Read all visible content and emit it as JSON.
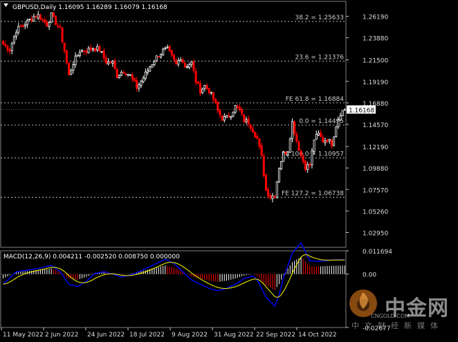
{
  "symbol_info": "GBPUSD,Daily",
  "ohlc": [
    "1.16095",
    "1.16289",
    "1.16079",
    "1.16168"
  ],
  "macd_label": "MACD(12,26,9)",
  "macd_values": [
    "0.004211",
    "-0.002520",
    "0.008750",
    "0.000000"
  ],
  "current_price": "1.16168",
  "colors": {
    "bull": "#ffffff",
    "bear": "#ff0000",
    "macd_line": "#0000ff",
    "signal_line": "#ffff00",
    "grid": "#808080"
  },
  "watermark": {
    "cn": "中金网",
    "en": "CNGOLD.COM",
    "sub": "中文财经新媒体"
  },
  "chart_data": {
    "type": "candlestick",
    "price_axis": {
      "ylim": [
        1.0135,
        1.2779
      ],
      "ticks": [
        "1.26190",
        "1.23880",
        "1.21500",
        "1.19190",
        "1.16880",
        "1.14570",
        "1.12190",
        "1.09880",
        "1.07570",
        "1.05260",
        "1.02950"
      ]
    },
    "time_axis": [
      "11 May 2022",
      "2 Jun 2022",
      "24 Jun 2022",
      "18 Jul 2022",
      "9 Aug 2022",
      "31 Aug 2022",
      "22 Sep 2022",
      "14 Oct 2022"
    ],
    "fib_levels": [
      {
        "label": "38.2 = 1.25633",
        "value": 1.25633
      },
      {
        "label": "23.6 = 1.21376",
        "value": 1.21376
      },
      {
        "label": "FE 61.8 = 1.16884",
        "value": 1.16884
      },
      {
        "label": "0.0 = 1.14495",
        "value": 1.14495
      },
      {
        "label": "FE 100.0 = 1.10957",
        "value": 1.10957
      },
      {
        "label": "FE 127.2 = 1.06738",
        "value": 1.06738
      }
    ],
    "macd_axis": {
      "ylim": [
        -0.02677,
        0.011694
      ],
      "ticks": [
        "0.011694",
        "0.00",
        "-0.02677"
      ]
    },
    "anchors": [
      [
        0,
        1.232
      ],
      [
        3,
        1.226
      ],
      [
        6,
        1.247
      ],
      [
        9,
        1.252
      ],
      [
        12,
        1.258
      ],
      [
        14,
        1.262
      ],
      [
        16,
        1.263
      ],
      [
        18,
        1.258
      ],
      [
        20,
        1.253
      ],
      [
        22,
        1.263
      ],
      [
        24,
        1.255
      ],
      [
        26,
        1.247
      ],
      [
        28,
        1.225
      ],
      [
        30,
        1.198
      ],
      [
        32,
        1.212
      ],
      [
        35,
        1.225
      ],
      [
        38,
        1.225
      ],
      [
        41,
        1.228
      ],
      [
        44,
        1.226
      ],
      [
        47,
        1.213
      ],
      [
        50,
        1.212
      ],
      [
        52,
        1.198
      ],
      [
        55,
        1.204
      ],
      [
        58,
        1.198
      ],
      [
        61,
        1.185
      ],
      [
        64,
        1.196
      ],
      [
        67,
        1.208
      ],
      [
        70,
        1.218
      ],
      [
        73,
        1.225
      ],
      [
        75,
        1.226
      ],
      [
        77,
        1.218
      ],
      [
        79,
        1.21
      ],
      [
        81,
        1.218
      ],
      [
        83,
        1.208
      ],
      [
        86,
        1.212
      ],
      [
        88,
        1.192
      ],
      [
        90,
        1.182
      ],
      [
        92,
        1.187
      ],
      [
        94,
        1.182
      ],
      [
        96,
        1.173
      ],
      [
        98,
        1.16
      ],
      [
        100,
        1.152
      ],
      [
        102,
        1.153
      ],
      [
        104,
        1.157
      ],
      [
        106,
        1.165
      ],
      [
        108,
        1.16
      ],
      [
        110,
        1.15
      ],
      [
        112,
        1.148
      ],
      [
        114,
        1.14
      ],
      [
        116,
        1.13
      ],
      [
        118,
        1.11
      ],
      [
        120,
        1.075
      ],
      [
        122,
        1.068
      ],
      [
        124,
        1.07
      ],
      [
        126,
        1.1
      ],
      [
        128,
        1.114
      ],
      [
        130,
        1.118
      ],
      [
        132,
        1.148
      ],
      [
        134,
        1.128
      ],
      [
        136,
        1.112
      ],
      [
        138,
        1.1
      ],
      [
        140,
        1.102
      ],
      [
        142,
        1.13
      ],
      [
        144,
        1.135
      ],
      [
        146,
        1.128
      ],
      [
        148,
        1.13
      ],
      [
        150,
        1.125
      ],
      [
        152,
        1.145
      ],
      [
        154,
        1.158
      ],
      [
        156,
        1.16168
      ]
    ],
    "macd_anchors": [
      [
        0,
        -0.0022
      ],
      [
        6,
        0.0011
      ],
      [
        12,
        0.0016
      ],
      [
        18,
        0.0022
      ],
      [
        22,
        0.0028
      ],
      [
        26,
        0.0011
      ],
      [
        30,
        -0.0022
      ],
      [
        34,
        -0.0028
      ],
      [
        38,
        -0.0014
      ],
      [
        42,
        0.0007
      ],
      [
        46,
        0.0011
      ],
      [
        50,
        0.0005
      ],
      [
        54,
        -0.0003
      ],
      [
        58,
        0.0002
      ],
      [
        62,
        0.0011
      ],
      [
        66,
        0.0022
      ],
      [
        70,
        0.0033
      ],
      [
        74,
        0.0044
      ],
      [
        78,
        0.0033
      ],
      [
        82,
        0.0011
      ],
      [
        86,
        -0.0011
      ],
      [
        90,
        -0.0022
      ],
      [
        94,
        -0.0033
      ],
      [
        98,
        -0.0039
      ],
      [
        102,
        -0.0033
      ],
      [
        106,
        -0.0022
      ],
      [
        110,
        -0.0007
      ],
      [
        114,
        0.0
      ],
      [
        116,
        -0.0011
      ],
      [
        118,
        -0.0033
      ],
      [
        120,
        -0.0056
      ],
      [
        124,
        -0.008
      ],
      [
        126,
        -0.005
      ],
      [
        128,
        -0.0005
      ],
      [
        132,
        0.006
      ],
      [
        136,
        0.0087
      ],
      [
        140,
        0.004
      ],
      [
        144,
        0.0038
      ],
      [
        150,
        0.0042
      ],
      [
        156,
        0.0043
      ]
    ]
  }
}
